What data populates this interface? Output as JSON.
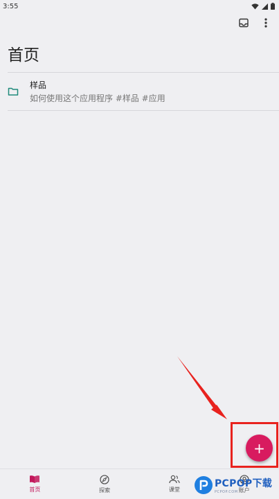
{
  "status_bar": {
    "time": "3:55"
  },
  "header": {
    "title": "首页"
  },
  "list": {
    "items": [
      {
        "title": "样品",
        "subtitle": "如何使用这个应用程序 #样品 #应用"
      }
    ]
  },
  "fab": {
    "label": "+"
  },
  "bottom_nav": {
    "items": [
      {
        "label": "首页",
        "icon": "book-open-icon",
        "active": true
      },
      {
        "label": "探索",
        "icon": "compass-icon",
        "active": false
      },
      {
        "label": "课堂",
        "icon": "people-icon",
        "active": false
      },
      {
        "label": "账户",
        "icon": "account-icon",
        "active": false
      }
    ]
  },
  "watermark": {
    "text": "PCPOP下载",
    "subtext": "PCPOP.COM"
  },
  "colors": {
    "accent": "#d81b5f",
    "folder": "#1f8a7a",
    "annotation": "#e8221e"
  }
}
